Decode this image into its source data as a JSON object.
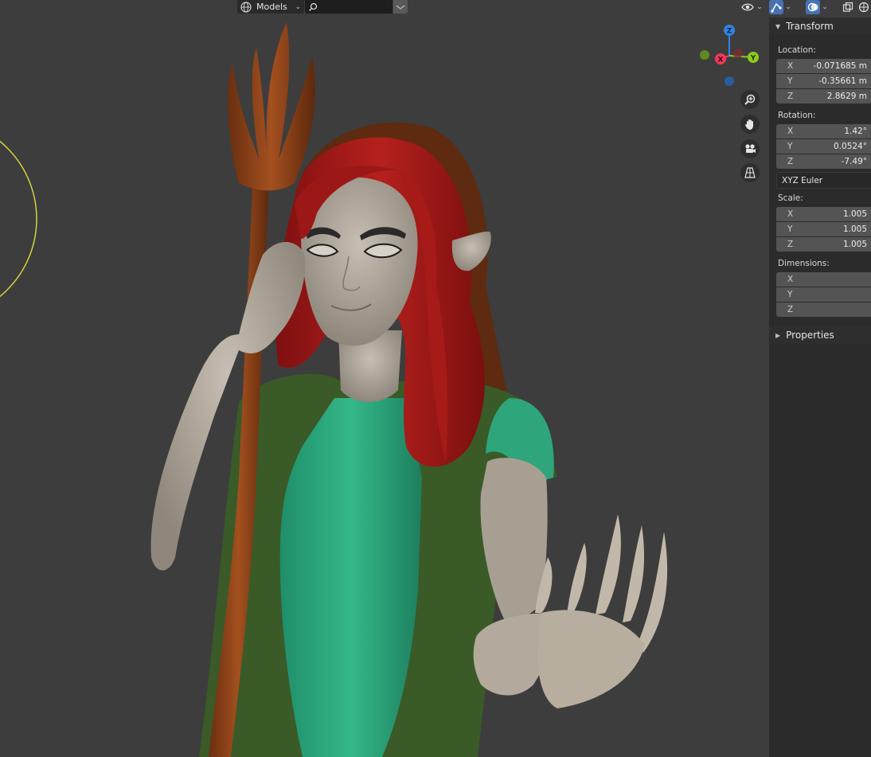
{
  "header": {
    "collection_label": "Models",
    "search_placeholder": ""
  },
  "toolbar": {
    "visibility_icon": "eye-icon",
    "gizmo_toggle_icon": "gizmo-icon",
    "overlay_icon": "overlay-icon",
    "xray_icon": "xray-icon",
    "shading_icon": "solid-shading-icon"
  },
  "gizmo": {
    "z_label": "Z",
    "x_label": "X",
    "y_label": "Y",
    "colors": {
      "x": "#f0385a",
      "y": "#8ccb1d",
      "z": "#2f85e3"
    }
  },
  "nav_buttons": [
    "zoom-icon",
    "pan-hand-icon",
    "camera-icon",
    "perspective-grid-icon"
  ],
  "transform": {
    "title": "Transform",
    "location_label": "Location:",
    "location": [
      {
        "axis": "X",
        "value": "-0.071685 m"
      },
      {
        "axis": "Y",
        "value": "-0.35661 m"
      },
      {
        "axis": "Z",
        "value": "2.8629 m"
      }
    ],
    "rotation_label": "Rotation:",
    "rotation": [
      {
        "axis": "X",
        "value": "1.42°"
      },
      {
        "axis": "Y",
        "value": "0.0524°"
      },
      {
        "axis": "Z",
        "value": "-7.49°"
      }
    ],
    "rotation_mode": "XYZ Euler",
    "scale_label": "Scale:",
    "scale": [
      {
        "axis": "X",
        "value": "1.005"
      },
      {
        "axis": "Y",
        "value": "1.005"
      },
      {
        "axis": "Z",
        "value": "1.005"
      }
    ],
    "dimensions_label": "Dimensions:",
    "dimensions": [
      {
        "axis": "X",
        "value": ""
      },
      {
        "axis": "Y",
        "value": ""
      },
      {
        "axis": "Z",
        "value": ""
      }
    ]
  },
  "properties": {
    "title": "Properties"
  }
}
